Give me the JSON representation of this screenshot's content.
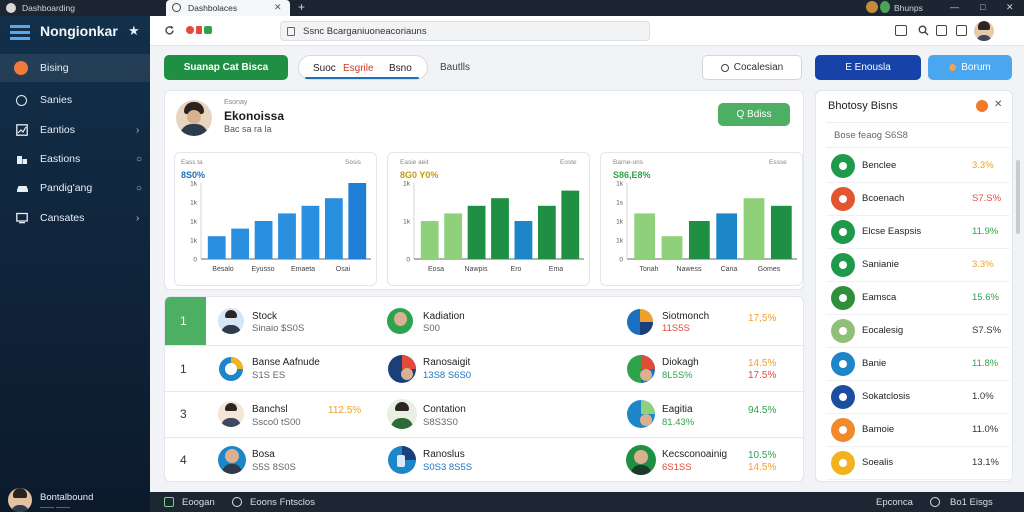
{
  "browser": {
    "window_title": "Dashboarding",
    "tab_title": "Dashbolaces",
    "tab_new": "+",
    "address_text": "Ssnc Bcarganiuoneacoriauns",
    "profile_name": "Bhunps",
    "win_min": "—",
    "win_max": "□",
    "win_close": "✕"
  },
  "sidebar": {
    "brand": "Nongionkar",
    "items": [
      {
        "label": "Bising",
        "icon": "home-icon",
        "chevron": ""
      },
      {
        "label": "Sanies",
        "icon": "circle-icon",
        "chevron": ""
      },
      {
        "label": "Eantios",
        "icon": "chart-icon",
        "chevron": "›"
      },
      {
        "label": "Eastions",
        "icon": "building-icon",
        "chevron": "○"
      },
      {
        "label": "Pandig'ang",
        "icon": "car-icon",
        "chevron": "○"
      },
      {
        "label": "Cansates",
        "icon": "screen-icon",
        "chevron": "›"
      }
    ],
    "user": {
      "name": "Bontalbound",
      "sub": "—— ——"
    }
  },
  "toolbar": {
    "primary_btn": "Suanap Cat Bisca",
    "seg_btn_a": "Suoc",
    "seg_btn_b": "Esgrile",
    "seg_btn_c": "Bsno",
    "seg_btn_d": "Bautlls",
    "outline_btn": "Cocalesian",
    "blue_btn": "E Enousla",
    "light_btn": "Borum"
  },
  "profile_card": {
    "kicker": "Esonay",
    "title": "Ekonoissa",
    "subtitle": "Bac sa ra la",
    "action": "Q Bdiss"
  },
  "charts": {
    "c1": {
      "k1": "Eass ta",
      "k2": "Sosis",
      "value": "8S0%",
      "yt": [
        "1k",
        "1k",
        "1k",
        "1k",
        "0"
      ],
      "xt": [
        "Besalo",
        "Eyusso",
        "Emaeta",
        "Osai"
      ]
    },
    "c2": {
      "k1": "Easie aeit",
      "k2": "Eoste",
      "value": "8G0 Y0%",
      "yt": [
        "1k",
        "1k",
        "0"
      ],
      "xt": [
        "Eosa",
        "Nawpis",
        "Ero",
        "Ema"
      ]
    },
    "c3": {
      "k1": "Barne-uns",
      "k2": "Essse",
      "value": "S86,E8%",
      "yt": [
        "1k",
        "1s",
        "1k",
        "1k",
        "0"
      ],
      "xt": [
        "Tonah",
        "Nawess",
        "Cana",
        "Gomes"
      ]
    }
  },
  "chart_data": [
    {
      "type": "bar",
      "categories": [
        "Besalo",
        "Eyusso",
        "Emaeta",
        "Osai"
      ],
      "series": [
        {
          "values": [
            3,
            4,
            5,
            6,
            7,
            8,
            10
          ]
        }
      ],
      "ylim": [
        0,
        10
      ]
    },
    {
      "type": "bar",
      "categories": [
        "Eosa",
        "Nawpis",
        "Ero",
        "Ema"
      ],
      "series": [
        {
          "values": [
            5,
            6,
            7,
            8,
            5,
            7,
            9
          ]
        }
      ],
      "ylim": [
        0,
        10
      ]
    },
    {
      "type": "bar",
      "categories": [
        "Tonah",
        "Nawess",
        "Cana",
        "Gomes"
      ],
      "series": [
        {
          "values": [
            6,
            3,
            5,
            6,
            8,
            7
          ]
        }
      ],
      "ylim": [
        0,
        10
      ]
    }
  ],
  "table": {
    "rows": [
      {
        "num": "1",
        "c1_name": "Stock",
        "c1_sub": "Sinaio $S0S",
        "c2_name": "Kadiation",
        "c2_sub": "S00",
        "c3_name": "Siotmonch",
        "c3_sub": "11S5S",
        "c3_pct": "17,5%"
      },
      {
        "num": "1",
        "c1_name": "Banse Aafnude",
        "c1_sub": "S1S ES",
        "c2_name": "Ranosaigit",
        "c2_sub": "13S8 S6S0",
        "c3_name": "Diokagh",
        "c3_sub": "8L5S%",
        "c3_pct": "14.5%",
        "c3_pct2": "17.5%"
      },
      {
        "num": "3",
        "c1_name": "Banchsl",
        "c1_sub": "Ssco0 tS00",
        "c1_pct": "112.5%",
        "c2_name": "Contation",
        "c2_sub": "S8S3S0",
        "c3_name": "Eagitia",
        "c3_sub": "81.43%",
        "c3_pct": "94.5%"
      },
      {
        "num": "4",
        "c1_name": "Bosa",
        "c1_sub": "S5S 8S0S",
        "c2_name": "Ranoslus",
        "c2_sub": "S0S3 8S5S",
        "c3_name": "Kecsconoainig",
        "c3_sub": "6S1SS",
        "c3_pct": "10.5%",
        "c3_pct2": "14.5%"
      }
    ]
  },
  "right_panel": {
    "title": "Bhotosy Bisns",
    "search": "Bose feaog S6S8",
    "items": [
      {
        "name": "Benclee",
        "pct": "3.3%",
        "tone": "o",
        "color": "#1f9a4a"
      },
      {
        "name": "Bcoenach",
        "pct": "S7.S%",
        "tone": "r",
        "color": "#e2552f"
      },
      {
        "name": "Elcse Easpsis",
        "pct": "11.9%",
        "tone": "g",
        "color": "#1f9a4a"
      },
      {
        "name": "Sanianie",
        "pct": "3.3%",
        "tone": "o",
        "color": "#1f9a4a"
      },
      {
        "name": "Eamsca",
        "pct": "15.6%",
        "tone": "g",
        "color": "#2f8f3a"
      },
      {
        "name": "Eocalesig",
        "pct": "S7.S%",
        "tone": "d",
        "color": "#8fbf7a"
      },
      {
        "name": "Banie",
        "pct": "11.8%",
        "tone": "g",
        "color": "#1d86c9"
      },
      {
        "name": "Sokatclosis",
        "pct": "1.0%",
        "tone": "d",
        "color": "#1c4ea0"
      },
      {
        "name": "Bamoie",
        "pct": "11.0%",
        "tone": "d",
        "color": "#f08a2a"
      },
      {
        "name": "Soealis",
        "pct": "13.1%",
        "tone": "d",
        "color": "#f2b11e"
      }
    ]
  },
  "bottombar": {
    "left_a": "Eoogan",
    "left_b": "Eoons Fntsclos",
    "right_a": "Epconca",
    "right_b": "Bo1 Eisgs"
  }
}
